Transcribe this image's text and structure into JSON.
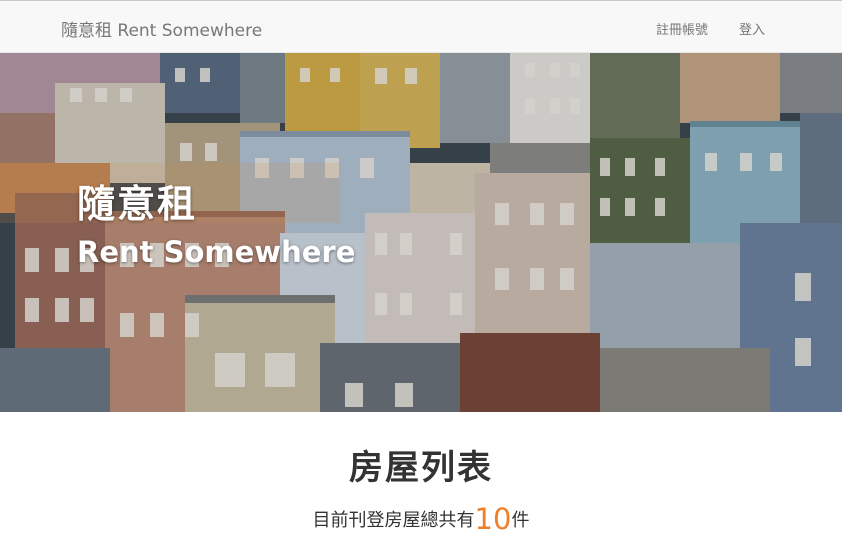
{
  "navbar": {
    "brand": "隨意租 Rent Somewhere",
    "links": [
      {
        "label": "註冊帳號"
      },
      {
        "label": "登入"
      }
    ]
  },
  "hero": {
    "title": "隨意租",
    "subtitle": "Rent Somewhere"
  },
  "listing": {
    "heading": "房屋列表",
    "count_prefix": "目前刊登房屋總共有",
    "count": "10",
    "count_suffix": "件"
  },
  "colors": {
    "accent": "#f07f2a",
    "navbar_bg": "#f8f8f8",
    "nav_text": "#777777"
  }
}
